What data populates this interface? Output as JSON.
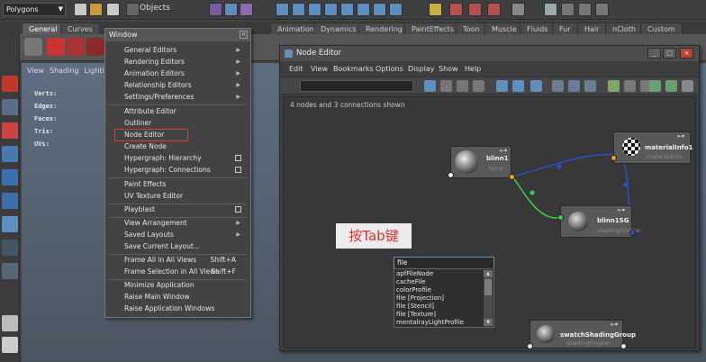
{
  "statusline": {
    "mode": "Polygons",
    "selection_mode": "Objects"
  },
  "shelf_tabs": [
    "General",
    "Curves",
    "Animation",
    "Dynamics",
    "Rendering",
    "PaintEffects",
    "Toon",
    "Muscle",
    "Fluids",
    "Fur",
    "Hair",
    "nCloth",
    "Custom"
  ],
  "viewport": {
    "menu": [
      "View",
      "Shading",
      "Lighti"
    ],
    "hud": [
      "Verts:",
      "Edges:",
      "Faces:",
      "Tris:",
      "UVs:"
    ]
  },
  "window_menu": {
    "title": "Window",
    "items": [
      {
        "label": "General Editors",
        "submenu": true
      },
      {
        "label": "Rendering Editors",
        "submenu": true
      },
      {
        "label": "Animation Editors",
        "submenu": true
      },
      {
        "label": "Relationship Editors",
        "submenu": true
      },
      {
        "label": "Settings/Preferences",
        "submenu": true
      },
      {
        "label": "Attribute Editor"
      },
      {
        "label": "Outliner"
      },
      {
        "label": "Node Editor",
        "highlighted": true
      },
      {
        "label": "Create Node"
      },
      {
        "label": "Hypergraph: Hierarchy",
        "option_box": true
      },
      {
        "label": "Hypergraph: Connections",
        "option_box": true
      },
      {
        "label": "Paint Effects"
      },
      {
        "label": "UV Texture Editor"
      },
      {
        "label": "Playblast",
        "option_box": true
      },
      {
        "label": "View Arrangement",
        "submenu": true
      },
      {
        "label": "Saved Layouts",
        "submenu": true
      },
      {
        "label": "Save Current Layout..."
      },
      {
        "label": "Frame All in All Views",
        "shortcut": "Shift+A"
      },
      {
        "label": "Frame Selection in All Views",
        "shortcut": "Shift+F"
      },
      {
        "label": "Minimize Application"
      },
      {
        "label": "Raise Main Window"
      },
      {
        "label": "Raise Application Windows"
      }
    ]
  },
  "node_editor": {
    "title": "Node Editor",
    "menu": [
      "Edit",
      "View",
      "Bookmarks",
      "Options",
      "Display",
      "Show",
      "Help"
    ],
    "info": "4 nodes and 3 connections shown",
    "nodes": [
      {
        "name": "blinn1",
        "type": "blinn"
      },
      {
        "name": "materialInfo1",
        "type": "materialInfo"
      },
      {
        "name": "blinn1SG",
        "type": "shadingEngine"
      },
      {
        "name": "swatchShadingGroup",
        "type": "shadingEngine"
      }
    ]
  },
  "annotation": "按Tab键",
  "tab_search": {
    "query": "file",
    "results": [
      "apfFileNode",
      "cacheFile",
      "colorProfile",
      "file  [Projection]",
      "file  [Stencil]",
      "file  [Texture]",
      "mentalrayLightProfile"
    ]
  },
  "colors": {
    "highlight_box": "#e23a3a",
    "annotation_text": "#e23030",
    "port_orange": "#f0a020",
    "port_blue": "#2a4fd0",
    "port_green": "#3bd34a"
  }
}
